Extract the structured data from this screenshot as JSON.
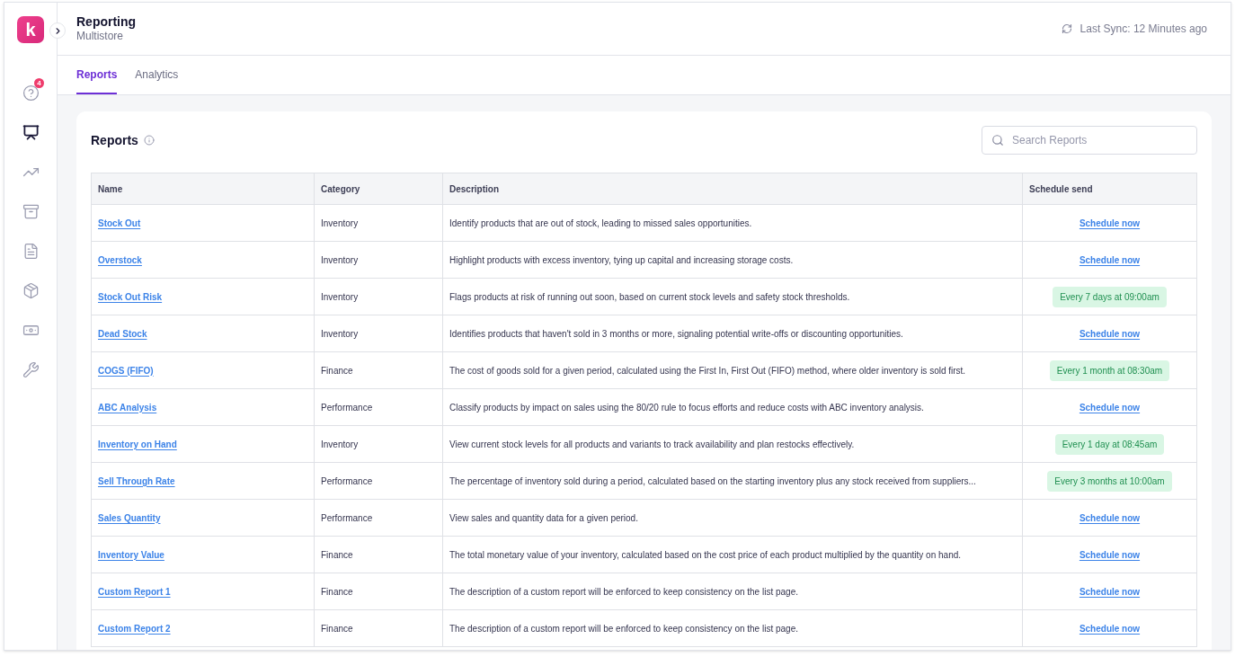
{
  "app": {
    "logo": "k"
  },
  "sidebar": {
    "items": [
      {
        "selected": false,
        "badge": "4"
      },
      {
        "selected": true
      },
      {
        "selected": false
      },
      {
        "selected": false
      },
      {
        "selected": false
      },
      {
        "selected": false
      },
      {
        "selected": false
      },
      {
        "selected": false
      }
    ]
  },
  "header": {
    "title": "Reporting",
    "subtitle": "Multistore",
    "sync": "Last Sync: 12 Minutes ago"
  },
  "tabs": [
    {
      "label": "Reports",
      "selected": true
    },
    {
      "label": "Analytics",
      "selected": false
    }
  ],
  "card": {
    "title": "Reports",
    "search": {
      "placeholder": "Search Reports"
    }
  },
  "table": {
    "columns": [
      "Name",
      "Category",
      "Description",
      "Schedule send"
    ],
    "rows": [
      {
        "name": "Stock Out",
        "category": "Inventory",
        "description": "Identify products that are out of stock, leading to missed sales opportunities.",
        "schedule": {
          "kind": "link",
          "text": "Schedule now"
        }
      },
      {
        "name": "Overstock",
        "category": "Inventory",
        "description": "Highlight products with excess inventory, tying up capital and increasing storage costs.",
        "schedule": {
          "kind": "link",
          "text": "Schedule now"
        }
      },
      {
        "name": "Stock Out Risk",
        "category": "Inventory",
        "description": "Flags products at risk of running out soon, based on current stock levels and safety stock thresholds.",
        "schedule": {
          "kind": "badge",
          "text": "Every 7 days at 09:00am"
        }
      },
      {
        "name": "Dead Stock",
        "category": "Inventory",
        "description": "Identifies products that haven't sold in 3 months or more, signaling potential write-offs or discounting opportunities.",
        "schedule": {
          "kind": "link",
          "text": "Schedule now"
        }
      },
      {
        "name": "COGS (FIFO)",
        "category": "Finance",
        "description": "The cost of goods sold for a given period, calculated using the First In, First Out (FIFO) method, where older inventory is sold first.",
        "schedule": {
          "kind": "badge",
          "text": "Every 1 month at 08:30am"
        }
      },
      {
        "name": "ABC Analysis",
        "category": "Performance",
        "description": "Classify products by impact on sales using the 80/20 rule to focus efforts and reduce costs with ABC inventory analysis.",
        "schedule": {
          "kind": "link",
          "text": "Schedule now"
        }
      },
      {
        "name": "Inventory on Hand",
        "category": "Inventory",
        "description": "View current stock levels for all products and variants to track availability and plan restocks effectively.",
        "schedule": {
          "kind": "badge",
          "text": "Every 1 day at 08:45am"
        }
      },
      {
        "name": "Sell Through Rate",
        "category": "Performance",
        "description": "The percentage of inventory sold during a period, calculated based on the starting inventory plus any stock received from suppliers...",
        "schedule": {
          "kind": "badge",
          "text": "Every 3 months at 10:00am"
        }
      },
      {
        "name": "Sales Quantity",
        "category": "Performance",
        "description": "View sales and quantity data for a given period.",
        "schedule": {
          "kind": "link",
          "text": "Schedule now"
        }
      },
      {
        "name": "Inventory Value",
        "category": "Finance",
        "description": "The total monetary value of your inventory, calculated based on the cost price of each product multiplied by the quantity on hand.",
        "schedule": {
          "kind": "link",
          "text": "Schedule now"
        }
      },
      {
        "name": "Custom Report 1",
        "category": "Finance",
        "description": "The description of a custom report will be enforced to keep consistency on the list page.",
        "schedule": {
          "kind": "link",
          "text": "Schedule now"
        }
      },
      {
        "name": "Custom Report 2",
        "category": "Finance",
        "description": "The description of a custom report will be enforced to keep consistency on the list page.",
        "schedule": {
          "kind": "link",
          "text": "Schedule now"
        }
      }
    ]
  }
}
